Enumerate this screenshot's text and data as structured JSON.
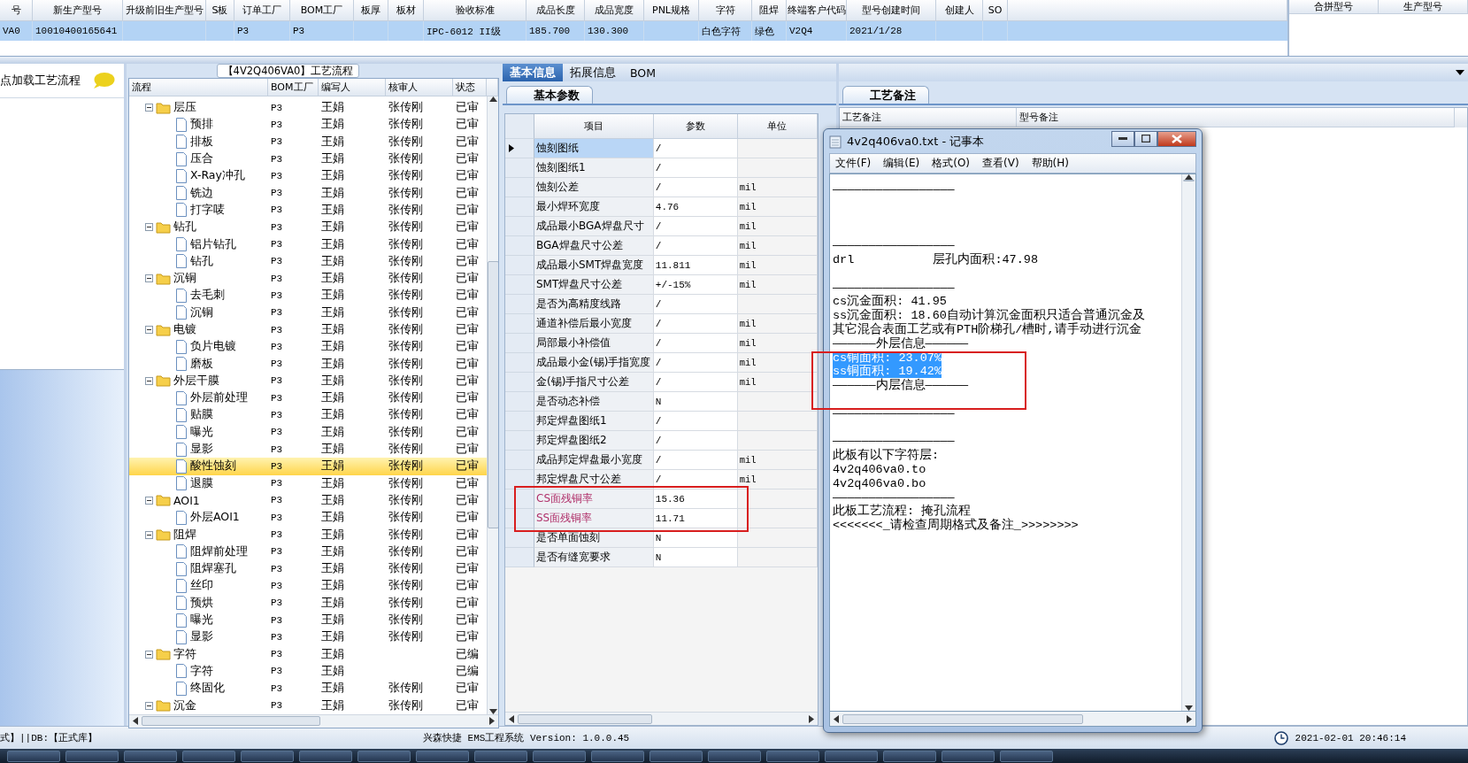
{
  "grid": {
    "columns": [
      "号",
      "新生产型号",
      "升级前旧生产型号",
      "S板",
      "订单工厂",
      "BOM工厂",
      "板厚",
      "板材",
      "验收标准",
      "成品长度",
      "成品宽度",
      "PNL规格",
      "字符",
      "阻焊",
      "终端客户代码",
      "型号创建时间",
      "创建人",
      "SO"
    ],
    "rows": [
      {
        "selected": true,
        "cells": [
          {
            "text": "VA0"
          },
          {
            "text": "10010400165641"
          },
          {},
          {},
          {
            "text": "P3"
          },
          {
            "text": "P3"
          },
          {},
          {},
          {
            "text": "IPC-6012 II级"
          },
          {
            "text": "185.700"
          },
          {
            "text": "130.300"
          },
          {},
          {
            "text": "白色字符"
          },
          {
            "text": "绿色"
          },
          {
            "text": "V2Q4"
          },
          {
            "text": "2021/1/28"
          },
          {},
          {}
        ]
      }
    ]
  },
  "side_grid": {
    "columns": [
      "合拼型号",
      "生产型号"
    ]
  },
  "load_panel": {
    "label": "点加载工艺流程"
  },
  "process_tree": {
    "title": "【4V2Q406VA0】工艺流程",
    "columns": [
      "流程",
      "BOM工厂",
      "编写人",
      "核审人",
      "状态"
    ],
    "rows": [
      {
        "name": "层压",
        "expanded": true,
        "selected": false,
        "bom": "P3",
        "writer": "王娟",
        "reviewer": "张传刚",
        "status": "已审",
        "children": [
          {
            "name": "预排",
            "selected": false,
            "bom": "P3",
            "writer": "王娟",
            "reviewer": "张传刚",
            "status": "已审"
          },
          {
            "name": "排板",
            "selected": false,
            "bom": "P3",
            "writer": "王娟",
            "reviewer": "张传刚",
            "status": "已审"
          },
          {
            "name": "压合",
            "selected": false,
            "bom": "P3",
            "writer": "王娟",
            "reviewer": "张传刚",
            "status": "已审"
          },
          {
            "name": "X-Ray冲孔",
            "selected": false,
            "bom": "P3",
            "writer": "王娟",
            "reviewer": "张传刚",
            "status": "已审"
          },
          {
            "name": "铣边",
            "selected": false,
            "bom": "P3",
            "writer": "王娟",
            "reviewer": "张传刚",
            "status": "已审"
          },
          {
            "name": "打字唛",
            "selected": false,
            "bom": "P3",
            "writer": "王娟",
            "reviewer": "张传刚",
            "status": "已审"
          }
        ]
      },
      {
        "name": "钻孔",
        "expanded": true,
        "selected": false,
        "bom": "P3",
        "writer": "王娟",
        "reviewer": "张传刚",
        "status": "已审",
        "children": [
          {
            "name": "铝片钻孔",
            "selected": false,
            "bom": "P3",
            "writer": "王娟",
            "reviewer": "张传刚",
            "status": "已审"
          },
          {
            "name": "钻孔",
            "selected": false,
            "bom": "P3",
            "writer": "王娟",
            "reviewer": "张传刚",
            "status": "已审"
          }
        ]
      },
      {
        "name": "沉铜",
        "expanded": true,
        "selected": false,
        "bom": "P3",
        "writer": "王娟",
        "reviewer": "张传刚",
        "status": "已审",
        "children": [
          {
            "name": "去毛刺",
            "selected": false,
            "bom": "P3",
            "writer": "王娟",
            "reviewer": "张传刚",
            "status": "已审"
          },
          {
            "name": "沉铜",
            "selected": false,
            "bom": "P3",
            "writer": "王娟",
            "reviewer": "张传刚",
            "status": "已审"
          }
        ]
      },
      {
        "name": "电镀",
        "expanded": true,
        "selected": false,
        "bom": "P3",
        "writer": "王娟",
        "reviewer": "张传刚",
        "status": "已审",
        "children": [
          {
            "name": "负片电镀",
            "selected": false,
            "bom": "P3",
            "writer": "王娟",
            "reviewer": "张传刚",
            "status": "已审"
          },
          {
            "name": "磨板",
            "selected": false,
            "bom": "P3",
            "writer": "王娟",
            "reviewer": "张传刚",
            "status": "已审"
          }
        ]
      },
      {
        "name": "外层干膜",
        "expanded": true,
        "selected": false,
        "bom": "P3",
        "writer": "王娟",
        "reviewer": "张传刚",
        "status": "已审",
        "children": [
          {
            "name": "外层前处理",
            "selected": false,
            "bom": "P3",
            "writer": "王娟",
            "reviewer": "张传刚",
            "status": "已审"
          },
          {
            "name": "贴膜",
            "selected": false,
            "bom": "P3",
            "writer": "王娟",
            "reviewer": "张传刚",
            "status": "已审"
          },
          {
            "name": "曝光",
            "selected": false,
            "bom": "P3",
            "writer": "王娟",
            "reviewer": "张传刚",
            "status": "已审"
          },
          {
            "name": "显影",
            "selected": false,
            "bom": "P3",
            "writer": "王娟",
            "reviewer": "张传刚",
            "status": "已审"
          },
          {
            "name": "酸性蚀刻",
            "selected": true,
            "bom": "P3",
            "writer": "王娟",
            "reviewer": "张传刚",
            "status": "已审"
          },
          {
            "name": "退膜",
            "selected": false,
            "bom": "P3",
            "writer": "王娟",
            "reviewer": "张传刚",
            "status": "已审"
          }
        ]
      },
      {
        "name": "AOI1",
        "expanded": true,
        "selected": false,
        "bom": "P3",
        "writer": "王娟",
        "reviewer": "张传刚",
        "status": "已审",
        "children": [
          {
            "name": "外层AOI1",
            "selected": false,
            "bom": "P3",
            "writer": "王娟",
            "reviewer": "张传刚",
            "status": "已审"
          }
        ]
      },
      {
        "name": "阻焊",
        "expanded": true,
        "selected": false,
        "bom": "P3",
        "writer": "王娟",
        "reviewer": "张传刚",
        "status": "已审",
        "children": [
          {
            "name": "阻焊前处理",
            "selected": false,
            "bom": "P3",
            "writer": "王娟",
            "reviewer": "张传刚",
            "status": "已审"
          },
          {
            "name": "阻焊塞孔",
            "selected": false,
            "bom": "P3",
            "writer": "王娟",
            "reviewer": "张传刚",
            "status": "已审"
          },
          {
            "name": "丝印",
            "selected": false,
            "bom": "P3",
            "writer": "王娟",
            "reviewer": "张传刚",
            "status": "已审"
          },
          {
            "name": "预烘",
            "selected": false,
            "bom": "P3",
            "writer": "王娟",
            "reviewer": "张传刚",
            "status": "已审"
          },
          {
            "name": "曝光",
            "selected": false,
            "bom": "P3",
            "writer": "王娟",
            "reviewer": "张传刚",
            "status": "已审"
          },
          {
            "name": "显影",
            "selected": false,
            "bom": "P3",
            "writer": "王娟",
            "reviewer": "张传刚",
            "status": "已审"
          }
        ]
      },
      {
        "name": "字符",
        "expanded": true,
        "selected": false,
        "bom": "P3",
        "writer": "王娟",
        "status": "已编",
        "children": [
          {
            "name": "字符",
            "selected": false,
            "bom": "P3",
            "writer": "王娟",
            "status": "已编"
          },
          {
            "name": "终固化",
            "selected": false,
            "bom": "P3",
            "writer": "王娟",
            "reviewer": "张传刚",
            "status": "已审"
          }
        ]
      },
      {
        "name": "沉金",
        "expanded": true,
        "selected": false,
        "bom": "P3",
        "writer": "王娟",
        "reviewer": "张传刚",
        "status": "已审"
      }
    ]
  },
  "detail_tabs": [
    {
      "label": "基本信息",
      "selected": true
    },
    {
      "label": "拓展信息",
      "selected": false
    },
    {
      "label": "BOM",
      "selected": false
    }
  ],
  "params": {
    "tab": "基本参数",
    "framed": true,
    "columns": [
      "项目",
      "参数",
      "单位"
    ],
    "rows": [
      {
        "item": "蚀刻图纸",
        "value": "/",
        "selected": true,
        "flagged": false
      },
      {
        "item": "蚀刻图纸1",
        "value": "/",
        "selected": false,
        "flagged": false
      },
      {
        "item": "蚀刻公差",
        "value": "/",
        "unit": "mil",
        "selected": false,
        "flagged": false
      },
      {
        "item": "最小焊环宽度",
        "value": "4.76",
        "unit": "mil",
        "selected": false,
        "flagged": false
      },
      {
        "item": "成品最小BGA焊盘尺寸",
        "value": "/",
        "unit": "mil",
        "selected": false,
        "flagged": false
      },
      {
        "item": "BGA焊盘尺寸公差",
        "value": "/",
        "unit": "mil",
        "selected": false,
        "flagged": false
      },
      {
        "item": "成品最小SMT焊盘宽度",
        "value": "11.811",
        "unit": "mil",
        "selected": false,
        "flagged": false
      },
      {
        "item": "SMT焊盘尺寸公差",
        "value": "+/-15%",
        "unit": "mil",
        "selected": false,
        "flagged": false
      },
      {
        "item": "是否为高精度线路",
        "value": "/",
        "selected": false,
        "flagged": false
      },
      {
        "item": "通道补偿后最小宽度",
        "value": "/",
        "unit": "mil",
        "selected": false,
        "flagged": false
      },
      {
        "item": "局部最小补偿值",
        "value": "/",
        "unit": "mil",
        "selected": false,
        "flagged": false
      },
      {
        "item": "成品最小金(锡)手指宽度",
        "value": "/",
        "unit": "mil",
        "selected": false,
        "flagged": false
      },
      {
        "item": "金(锡)手指尺寸公差",
        "value": "/",
        "unit": "mil",
        "selected": false,
        "flagged": false
      },
      {
        "item": "是否动态补偿",
        "value": "N",
        "selected": false,
        "flagged": false
      },
      {
        "item": "邦定焊盘图纸1",
        "value": "/",
        "selected": false,
        "flagged": false
      },
      {
        "item": "邦定焊盘图纸2",
        "value": "/",
        "selected": false,
        "flagged": false
      },
      {
        "item": "成品邦定焊盘最小宽度",
        "value": "/",
        "unit": "mil",
        "selected": false,
        "flagged": false
      },
      {
        "item": "邦定焊盘尺寸公差",
        "value": "/",
        "unit": "mil",
        "selected": false,
        "flagged": false
      },
      {
        "item": "CS面残铜率",
        "value": "15.36",
        "selected": false,
        "flagged": true
      },
      {
        "item": "SS面残铜率",
        "value": "11.71",
        "selected": false,
        "flagged": true
      },
      {
        "item": "是否单面蚀刻",
        "value": "N",
        "selected": false,
        "flagged": false
      },
      {
        "item": "是否有缝宽要求",
        "value": "N",
        "selected": false,
        "flagged": false
      }
    ]
  },
  "notes": {
    "tab": "工艺备注",
    "columns": [
      "工艺备注",
      "型号备注"
    ]
  },
  "notepad": {
    "title": "4v2q406va0.txt - 记事本",
    "framed": true,
    "menu": [
      "文件(F)",
      "编辑(E)",
      "格式(O)",
      "查看(V)",
      "帮助(H)"
    ],
    "lines": [
      {
        "kind": "text",
        "text": "—————————————————",
        "selected": false
      },
      {
        "kind": "blank"
      },
      {
        "kind": "blank"
      },
      {
        "kind": "blank"
      },
      {
        "kind": "text",
        "text": "—————————————————",
        "selected": false
      },
      {
        "kind": "text",
        "text": "drl           层孔内面积:47.98",
        "selected": false
      },
      {
        "kind": "blank"
      },
      {
        "kind": "text",
        "text": "—————————————————",
        "selected": false
      },
      {
        "kind": "text",
        "text": "cs沉金面积: 41.95",
        "selected": false
      },
      {
        "kind": "text",
        "text": "ss沉金面积: 18.60自动计算沉金面积只适合普通沉金及",
        "selected": false
      },
      {
        "kind": "text",
        "text": "其它混合表面工艺或有PTH阶梯孔/槽时,请手动进行沉金",
        "selected": false
      },
      {
        "kind": "text",
        "text": "——————外层信息——————",
        "selected": false
      },
      {
        "kind": "text",
        "text": "cs铜面积: 23.07%",
        "selected": true
      },
      {
        "kind": "text",
        "text": "ss铜面积: 19.42%",
        "selected": true
      },
      {
        "kind": "text",
        "text": "——————内层信息——————",
        "selected": false
      },
      {
        "kind": "blank"
      },
      {
        "kind": "text",
        "text": "—————————————————",
        "selected": false
      },
      {
        "kind": "blank"
      },
      {
        "kind": "text",
        "text": "—————————————————",
        "selected": false
      },
      {
        "kind": "text",
        "text": "此板有以下字符层:",
        "selected": false
      },
      {
        "kind": "text",
        "text": "4v2q406va0.to",
        "selected": false
      },
      {
        "kind": "text",
        "text": "4v2q406va0.bo",
        "selected": false
      },
      {
        "kind": "text",
        "text": "—————————————————",
        "selected": false
      },
      {
        "kind": "text",
        "text": "此板工艺流程: 掩孔流程",
        "selected": false
      },
      {
        "kind": "text",
        "text": "<<<<<<<_请检查周期格式及备注_>>>>>>>>",
        "selected": false
      }
    ]
  },
  "status_bar": {
    "left": "式】||DB:【正式库】",
    "center": "兴森快捷 EMS工程系统 Version: 1.0.0.45",
    "clock": "2021-02-01 20:46:14"
  }
}
